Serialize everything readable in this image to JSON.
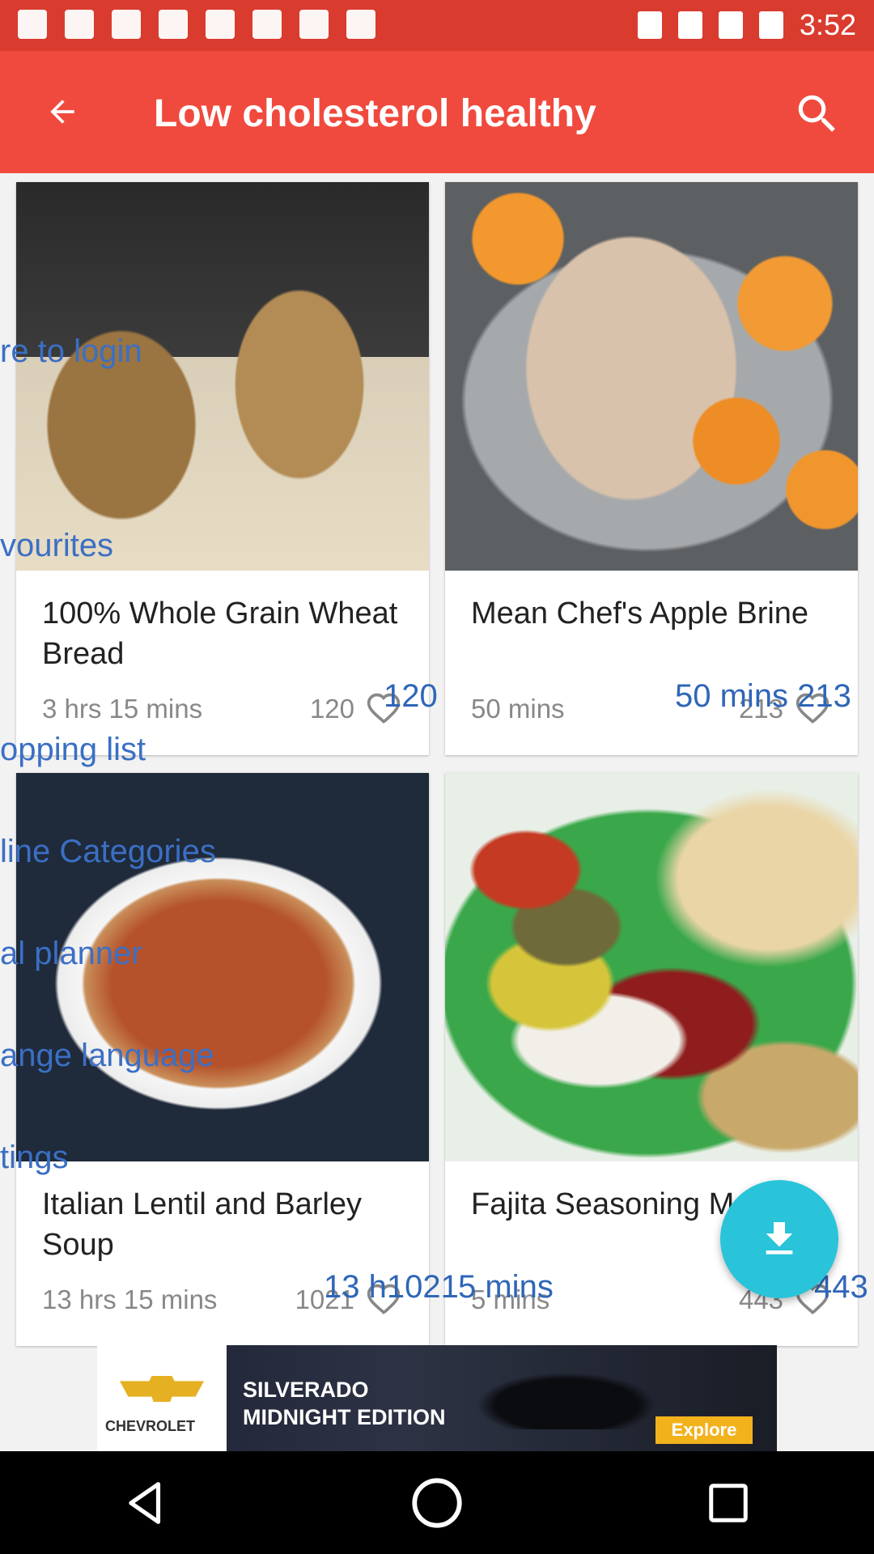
{
  "status_bar": {
    "time": "3:52"
  },
  "app_bar": {
    "title": "Low cholesterol healthy",
    "back_icon": "arrow-left-icon",
    "search_icon": "search-icon"
  },
  "recipes": [
    {
      "title": "100% Whole Grain Wheat Bread",
      "time": "3 hrs 15 mins",
      "likes": "120",
      "image": "bread"
    },
    {
      "title": "Mean Chef's Apple Brine",
      "time": "50 mins",
      "likes": "213",
      "image": "brine"
    },
    {
      "title": "Italian Lentil and Barley Soup",
      "time": "13 hrs 15 mins",
      "likes": "1021",
      "image": "lentil"
    },
    {
      "title": "Fajita Seasoning M",
      "time": "5 mins",
      "likes": "443",
      "image": "spice"
    }
  ],
  "drawer_ghost": {
    "items": [
      "re to login",
      "vourites",
      "opping list",
      "line Categories",
      "al planner",
      "ange language",
      "tings"
    ],
    "overlay_likes_1": "120",
    "overlay_row_1": "50 mins 213",
    "overlay_row_2a": "13 h1021",
    "overlay_row_2b": "5 mins",
    "overlay_row_2c": "443"
  },
  "fab": {
    "icon": "download-icon"
  },
  "ad": {
    "brand": "CHEVROLET",
    "headline": "SILVERADO MIDNIGHT EDITION",
    "cta": "Explore"
  },
  "nav_bar": {
    "icons": [
      "back-triangle-icon",
      "home-circle-icon",
      "recents-square-icon"
    ]
  },
  "colors": {
    "app_bar": "#f04a3e",
    "status_bar": "#d93c2f",
    "fab": "#29c4d9",
    "ghost_text": "#3b6fc4"
  }
}
